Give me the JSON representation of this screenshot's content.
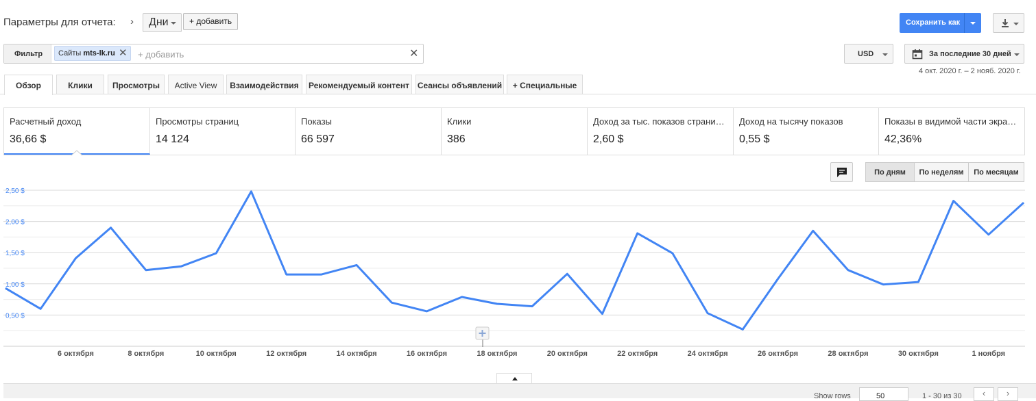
{
  "header": {
    "label": "Параметры для отчета:",
    "granularity": "Дни",
    "add_label": "+ добавить",
    "save_label": "Сохранить как"
  },
  "filter": {
    "label": "Фильтр",
    "chip_prefix": "Сайты",
    "chip_value": "mts-lk.ru",
    "add_placeholder": "+ добавить"
  },
  "currency": "USD",
  "date": {
    "label": "За последние 30 дней",
    "range": "4 окт. 2020 г. – 2 нояб. 2020 г."
  },
  "tabs": [
    {
      "label": "Обзор"
    },
    {
      "label": "Клики"
    },
    {
      "label": "Просмотры"
    },
    {
      "label": "Active View"
    },
    {
      "label": "Взаимодействия"
    },
    {
      "label": "Рекомендуемый контент"
    },
    {
      "label": "Сеансы объявлений"
    },
    {
      "label": "Специальные"
    }
  ],
  "metrics": [
    {
      "title": "Расчетный доход",
      "value": "36,66 $"
    },
    {
      "title": "Просмотры страниц",
      "value": "14 124"
    },
    {
      "title": "Показы",
      "value": "66 597"
    },
    {
      "title": "Клики",
      "value": "386"
    },
    {
      "title": "Доход за тыс. показов страни…",
      "value": "2,60 $"
    },
    {
      "title": "Доход на тысячу показов",
      "value": "0,55 $"
    },
    {
      "title": "Показы в видимой части экра…",
      "value": "42,36%"
    }
  ],
  "chart_controls": {
    "day": "По дням",
    "week": "По неделям",
    "month": "По месяцам"
  },
  "chart_data": {
    "type": "line",
    "title": "",
    "xlabel": "",
    "ylabel": "",
    "x_tick_labels": [
      "6 октября",
      "8 октября",
      "10 октября",
      "12 октября",
      "14 октября",
      "16 октября",
      "18 октября",
      "20 октября",
      "22 октября",
      "24 октября",
      "26 октября",
      "28 октября",
      "30 октября",
      "1 ноября"
    ],
    "y_tick_labels": [
      "2,50 $",
      "2,00 $",
      "1,50 $",
      "1,00 $",
      "0,50 $"
    ],
    "ylim": [
      0,
      2.75
    ],
    "grid": true,
    "series": [
      {
        "color": "#4285f4",
        "x": [
          "4 окт.",
          "5 окт.",
          "6 окт.",
          "7 окт.",
          "8 окт.",
          "9 окт.",
          "10 окт.",
          "11 окт.",
          "12 окт.",
          "13 окт.",
          "14 окт.",
          "15 окт.",
          "16 окт.",
          "17 окт.",
          "18 окт.",
          "19 окт.",
          "20 окт.",
          "21 окт.",
          "22 окт.",
          "23 окт.",
          "24 окт.",
          "25 окт.",
          "26 окт.",
          "27 окт.",
          "28 окт.",
          "29 окт.",
          "30 окт.",
          "31 окт.",
          "1 нояб.",
          "2 нояб."
        ],
        "values": [
          0.93,
          0.6,
          1.41,
          1.9,
          1.22,
          1.28,
          1.49,
          2.48,
          1.15,
          1.15,
          1.3,
          0.7,
          0.56,
          0.79,
          0.68,
          0.64,
          1.16,
          0.52,
          1.81,
          1.49,
          0.53,
          0.27,
          1.08,
          1.85,
          1.22,
          0.99,
          1.03,
          2.33,
          1.79,
          2.3
        ]
      }
    ]
  },
  "footer": {
    "show_rows_label": "Show rows",
    "rows_value": "50",
    "range_text": "1 - 30 из 30"
  }
}
